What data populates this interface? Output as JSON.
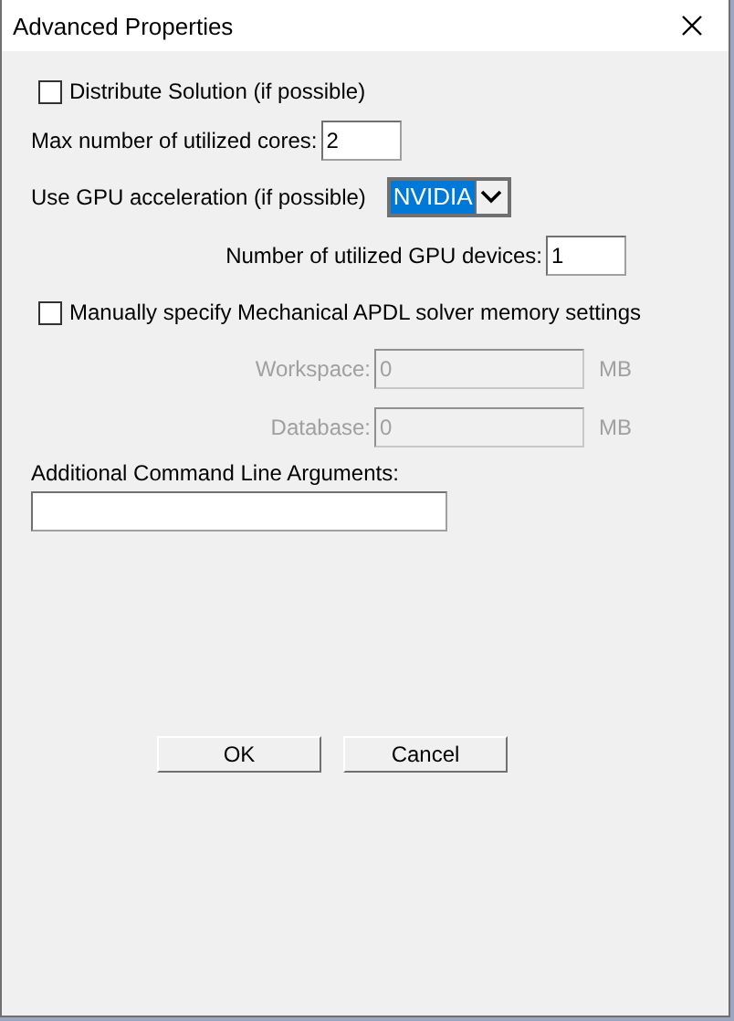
{
  "window": {
    "title": "Advanced Properties"
  },
  "distribute": {
    "label": "Distribute Solution (if possible)",
    "checked": false
  },
  "cores": {
    "label": "Max number of utilized cores:",
    "value": "2"
  },
  "gpu": {
    "label": "Use GPU acceleration (if possible)",
    "value": "NVIDIA"
  },
  "gpu_devices": {
    "label": "Number of utilized GPU devices:",
    "value": "1"
  },
  "manual_memory": {
    "label": "Manually specify Mechanical APDL solver memory settings",
    "checked": false
  },
  "memory_fields": [
    {
      "label": "Workspace:",
      "value": "0",
      "unit": "MB",
      "disabled": true
    },
    {
      "label": "Database:",
      "value": "0",
      "unit": "MB",
      "disabled": true
    }
  ],
  "command_line": {
    "label": "Additional Command Line Arguments:"
  },
  "buttons": [
    "OK",
    "Cancel"
  ]
}
